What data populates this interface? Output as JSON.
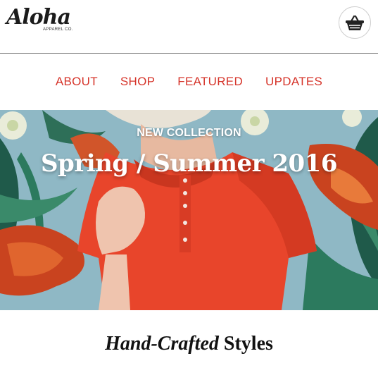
{
  "brand": {
    "logo_script": "Aloha",
    "logo_sub": "APPAREL CO."
  },
  "header": {
    "cart_icon": "shopping-basket-icon"
  },
  "nav": {
    "items": [
      {
        "label": "ABOUT"
      },
      {
        "label": "SHOP"
      },
      {
        "label": "FEATURED"
      },
      {
        "label": "UPDATES"
      }
    ]
  },
  "hero": {
    "eyebrow": "NEW COLLECTION",
    "title": "Spring / Summer 2016"
  },
  "section": {
    "heading_italic": "Hand-Crafted",
    "heading_bold": "Styles"
  },
  "colors": {
    "accent": "#d6342a",
    "shirt": "#e8452b",
    "sky": "#8fb8c5",
    "text": "#111111"
  }
}
